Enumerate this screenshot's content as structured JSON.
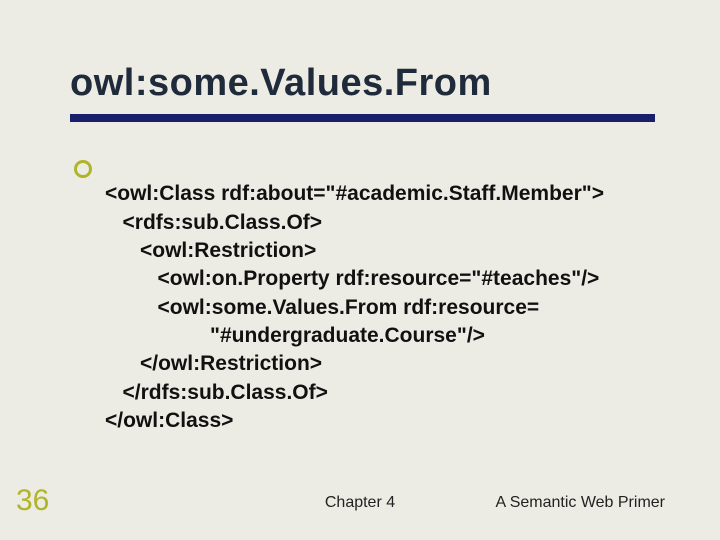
{
  "slide": {
    "title": "owl:some.Values.From",
    "code_lines": [
      "<owl:Class rdf:about=\"#academic.Staff.Member\">",
      "   <rdfs:sub.Class.Of>",
      "      <owl:Restriction>",
      "         <owl:on.Property rdf:resource=\"#teaches\"/>",
      "         <owl:some.Values.From rdf:resource=",
      "                  \"#undergraduate.Course\"/>",
      "      </owl:Restriction>",
      "   </rdfs:sub.Class.Of>",
      "</owl:Class>"
    ],
    "page_number": "36",
    "footer_center": "Chapter 4",
    "footer_right": "A Semantic Web Primer"
  }
}
